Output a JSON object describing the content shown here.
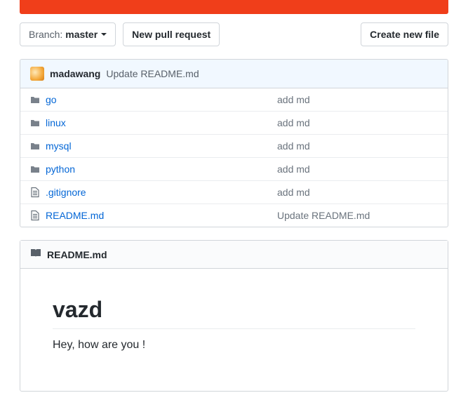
{
  "toolbar": {
    "branch_prefix": "Branch:",
    "branch_name": "master",
    "new_pr": "New pull request",
    "create_new_file": "Create new file"
  },
  "commit": {
    "author": "madawang",
    "message": "Update README.md"
  },
  "files": [
    {
      "type": "dir",
      "name": "go",
      "message": "add md"
    },
    {
      "type": "dir",
      "name": "linux",
      "message": "add md"
    },
    {
      "type": "dir",
      "name": "mysql",
      "message": "add md"
    },
    {
      "type": "dir",
      "name": "python",
      "message": "add md"
    },
    {
      "type": "file",
      "name": ".gitignore",
      "message": "add md"
    },
    {
      "type": "file",
      "name": "README.md",
      "message": "Update README.md"
    }
  ],
  "readme": {
    "filename": "README.md",
    "title": "vazd",
    "body": "Hey, how are you !"
  }
}
